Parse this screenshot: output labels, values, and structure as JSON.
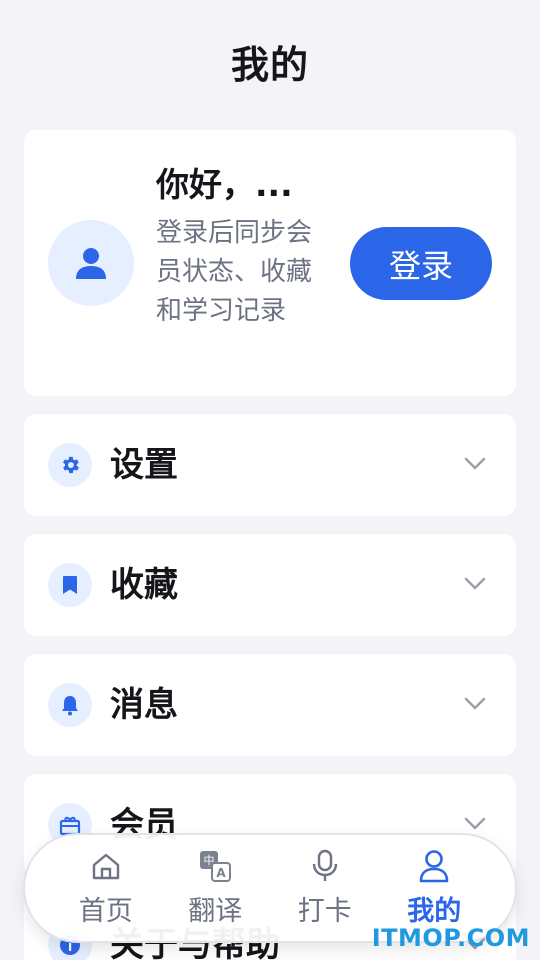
{
  "header": {
    "title": "我的"
  },
  "profile": {
    "greeting": "你好，...",
    "description": "登录后同步会员状态、收藏和学习记录",
    "login_label": "登录",
    "avatar_icon": "user-icon"
  },
  "menu": {
    "items": [
      {
        "label": "设置",
        "icon": "gear-icon"
      },
      {
        "label": "收藏",
        "icon": "bookmark-icon"
      },
      {
        "label": "消息",
        "icon": "bell-icon"
      },
      {
        "label": "会员",
        "icon": "gift-icon"
      },
      {
        "label": "关于与帮助",
        "icon": "info-icon"
      }
    ]
  },
  "tabbar": {
    "tabs": [
      {
        "label": "首页",
        "icon": "home-icon"
      },
      {
        "label": "翻译",
        "icon": "translate-icon"
      },
      {
        "label": "打卡",
        "icon": "microphone-icon"
      },
      {
        "label": "我的",
        "icon": "person-icon",
        "active": true
      }
    ]
  },
  "watermark": {
    "text": "ITMOP.COM"
  },
  "colors": {
    "accent": "#2c66e8",
    "background": "#f4f4f8",
    "icon_bg": "#e6efff",
    "muted_text": "#6d7382",
    "watermark": "#1f9ae0"
  }
}
